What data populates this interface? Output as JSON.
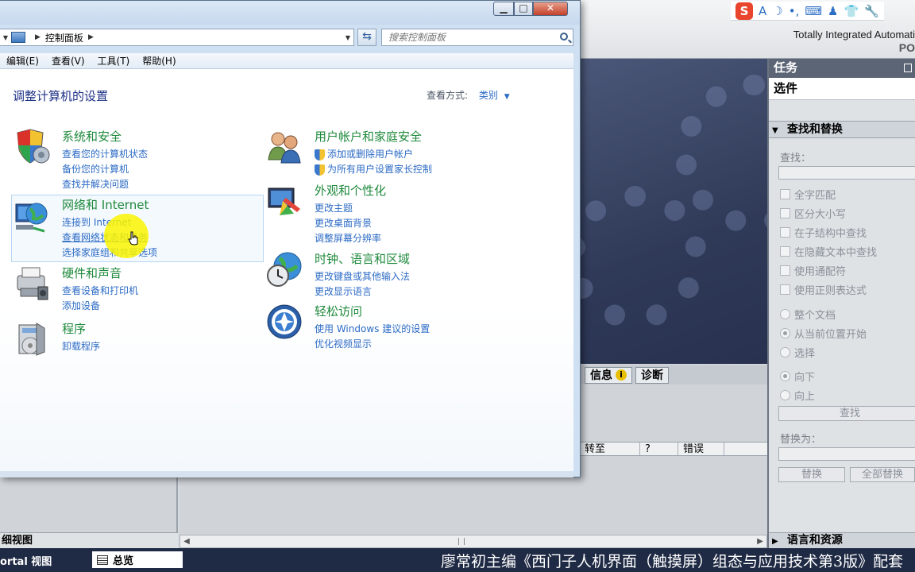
{
  "tia": {
    "brand_line1": "Totally Integrated Automati",
    "brand_line2": "PO",
    "info_tab": "信息",
    "diag_tab": "诊断",
    "columns": [
      "转至",
      "?",
      "错误"
    ],
    "detail_view": "细视图",
    "portal_view": "ortal 视图",
    "overview_tab": "总览",
    "caption": "廖常初主编《西门子人机界面（触摸屏）组态与应用技术第3版》配套"
  },
  "task_panel": {
    "header": "任务",
    "options": "选件",
    "find_replace_header": "查找和替换",
    "find_label": "查找：",
    "checkboxes": [
      "全字匹配",
      "区分大小写",
      "在子结构中查找",
      "在隐藏文本中查找",
      "使用通配符",
      "使用正则表达式"
    ],
    "scope_radios": [
      "整个文档",
      "从当前位置开始",
      "选择"
    ],
    "direction_radios": [
      "向下",
      "向上"
    ],
    "find_button": "查找",
    "replace_label": "替换为：",
    "replace_button": "替换",
    "replace_all_button": "全部替换",
    "lang_header": "语言和资源"
  },
  "ime_bar": {
    "logo": "S",
    "mode": "A"
  },
  "control_panel": {
    "address": {
      "crumb": "控制面板"
    },
    "search_placeholder": "搜索控制面板",
    "menu": [
      "编辑(E)",
      "查看(V)",
      "工具(T)",
      "帮助(H)"
    ],
    "heading": "调整计算机的设置",
    "view_by_label": "查看方式:",
    "view_by_value": "类别",
    "categories": [
      {
        "title": "系统和安全",
        "icon": "system-security-icon",
        "links": [
          "查看您的计算机状态",
          "备份您的计算机",
          "查找并解决问题"
        ]
      },
      {
        "title": "网络和 Internet",
        "icon": "network-internet-icon",
        "links": [
          "连接到 Internet",
          "查看网络状态和任务",
          "选择家庭组和共享选项"
        ]
      },
      {
        "title": "硬件和声音",
        "icon": "hardware-sound-icon",
        "links": [
          "查看设备和打印机",
          "添加设备"
        ]
      },
      {
        "title": "程序",
        "icon": "programs-icon",
        "links": [
          "卸载程序"
        ]
      },
      {
        "title": "用户帐户和家庭安全",
        "icon": "user-accounts-icon",
        "links": [
          "添加或删除用户帐户",
          "为所有用户设置家长控制"
        ]
      },
      {
        "title": "外观和个性化",
        "icon": "appearance-icon",
        "links": [
          "更改主题",
          "更改桌面背景",
          "调整屏幕分辨率"
        ]
      },
      {
        "title": "时钟、语言和区域",
        "icon": "clock-language-icon",
        "links": [
          "更改键盘或其他输入法",
          "更改显示语言"
        ]
      },
      {
        "title": "轻松访问",
        "icon": "ease-of-access-icon",
        "links": [
          "使用 Windows 建议的设置",
          "优化视频显示"
        ]
      }
    ]
  }
}
